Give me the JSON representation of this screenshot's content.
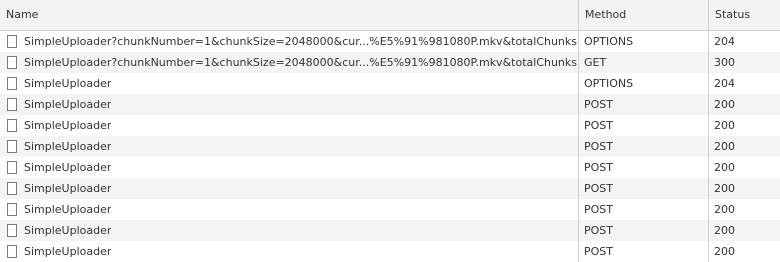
{
  "columns": {
    "name": "Name",
    "method": "Method",
    "status": "Status"
  },
  "rows": [
    {
      "name": "SimpleUploader?chunkNumber=1&chunkSize=2048000&cur...%E5%91%981080P.mkv&totalChunks=...",
      "method": "OPTIONS",
      "status": "204"
    },
    {
      "name": "SimpleUploader?chunkNumber=1&chunkSize=2048000&cur...%E5%91%981080P.mkv&totalChunks=...",
      "method": "GET",
      "status": "300"
    },
    {
      "name": "SimpleUploader",
      "method": "OPTIONS",
      "status": "204"
    },
    {
      "name": "SimpleUploader",
      "method": "POST",
      "status": "200"
    },
    {
      "name": "SimpleUploader",
      "method": "POST",
      "status": "200"
    },
    {
      "name": "SimpleUploader",
      "method": "POST",
      "status": "200"
    },
    {
      "name": "SimpleUploader",
      "method": "POST",
      "status": "200"
    },
    {
      "name": "SimpleUploader",
      "method": "POST",
      "status": "200"
    },
    {
      "name": "SimpleUploader",
      "method": "POST",
      "status": "200"
    },
    {
      "name": "SimpleUploader",
      "method": "POST",
      "status": "200"
    },
    {
      "name": "SimpleUploader",
      "method": "POST",
      "status": "200"
    }
  ],
  "icons": {
    "file": "file-icon"
  },
  "colors": {
    "header_bg": "#f3f3f3",
    "row_alt_bg": "#f4f4f4",
    "grid_line": "#cfcfcf",
    "text": "#333333"
  }
}
